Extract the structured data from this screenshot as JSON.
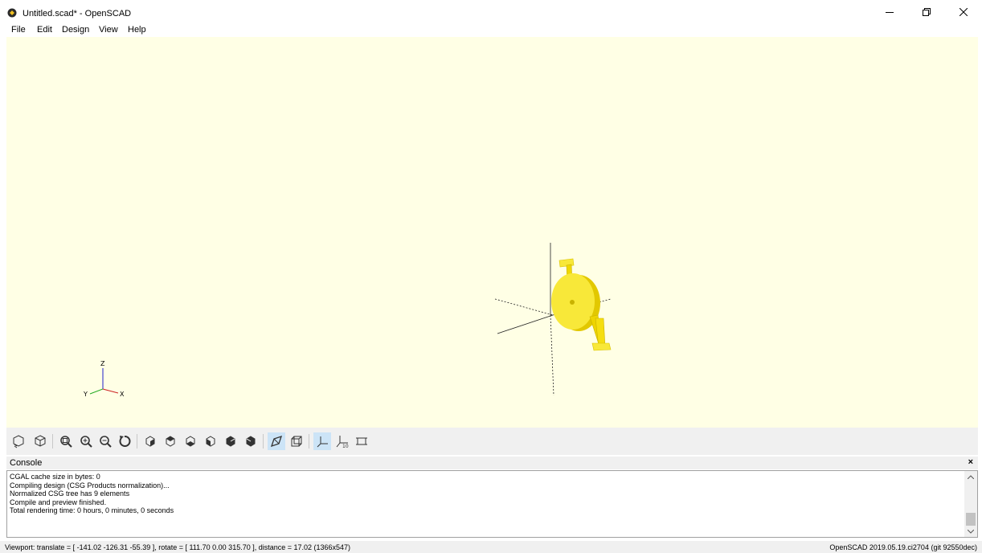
{
  "window": {
    "title": "Untitled.scad* - OpenSCAD"
  },
  "menu": {
    "items": [
      {
        "label": "File"
      },
      {
        "label": "Edit"
      },
      {
        "label": "Design"
      },
      {
        "label": "View"
      },
      {
        "label": "Help"
      }
    ]
  },
  "viewport": {
    "background": "#ffffe5",
    "model_color": "#f8e839",
    "axis_labels": {
      "z": "Z",
      "y": "Y",
      "x": "X"
    }
  },
  "toolbar": {
    "buttons": [
      {
        "icon": "render-icon"
      },
      {
        "icon": "preview-icon"
      },
      {
        "icon": "view-all-icon"
      },
      {
        "icon": "zoom-in-icon"
      },
      {
        "icon": "zoom-out-icon"
      },
      {
        "icon": "reset-view-icon"
      },
      {
        "icon": "view-right-icon"
      },
      {
        "icon": "view-top-icon"
      },
      {
        "icon": "view-bottom-icon"
      },
      {
        "icon": "view-left-icon"
      },
      {
        "icon": "view-front-icon"
      },
      {
        "icon": "view-back-icon"
      },
      {
        "icon": "perspective-icon",
        "active": true
      },
      {
        "icon": "orthogonal-icon"
      },
      {
        "icon": "show-axes-icon",
        "active": true
      },
      {
        "icon": "show-scale-markers-icon"
      },
      {
        "icon": "show-edges-icon"
      }
    ]
  },
  "console": {
    "title": "Console",
    "close_label": "×",
    "lines": [
      "CGAL cache size in bytes: 0",
      "Compiling design (CSG Products normalization)...",
      "Normalized CSG tree has 9 elements",
      "Compile and preview finished.",
      "Total rendering time: 0 hours, 0 minutes, 0 seconds"
    ]
  },
  "status": {
    "viewport": "Viewport: translate = [ -141.02 -126.31 -55.39 ], rotate = [ 111.70 0.00 315.70 ], distance = 17.02 (1366x547)",
    "version": "OpenSCAD 2019.05.19.ci2704 (git 92550dec)"
  }
}
